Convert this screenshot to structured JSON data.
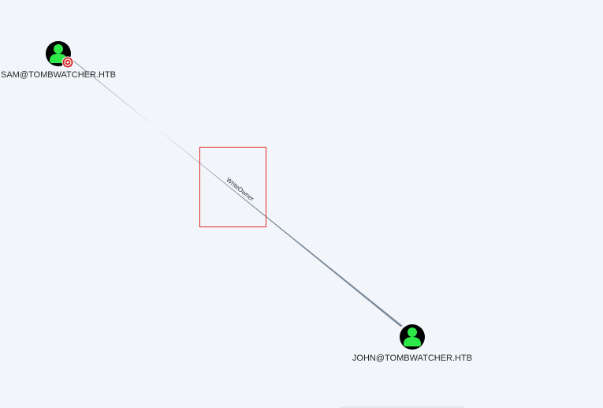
{
  "graph": {
    "nodes": [
      {
        "id": "sam",
        "label": "SAM@TOMBWATCHER.HTB",
        "type": "user",
        "is_target": true
      },
      {
        "id": "john",
        "label": "JOHN@TOMBWATCHER.HTB",
        "type": "user",
        "is_target": false
      }
    ],
    "edges": [
      {
        "from": "sam",
        "to": "john",
        "label": "WriteOwner"
      }
    ]
  },
  "colors": {
    "background": "#f2f5fa",
    "node_circle": "#000000",
    "user_icon": "#2ee84a",
    "target_badge": "#d42a2a",
    "edge": "#7a8a99",
    "selection_box": "#e02a2a"
  },
  "icons": {
    "user_node": "user-icon",
    "target_badge": "target-icon"
  }
}
